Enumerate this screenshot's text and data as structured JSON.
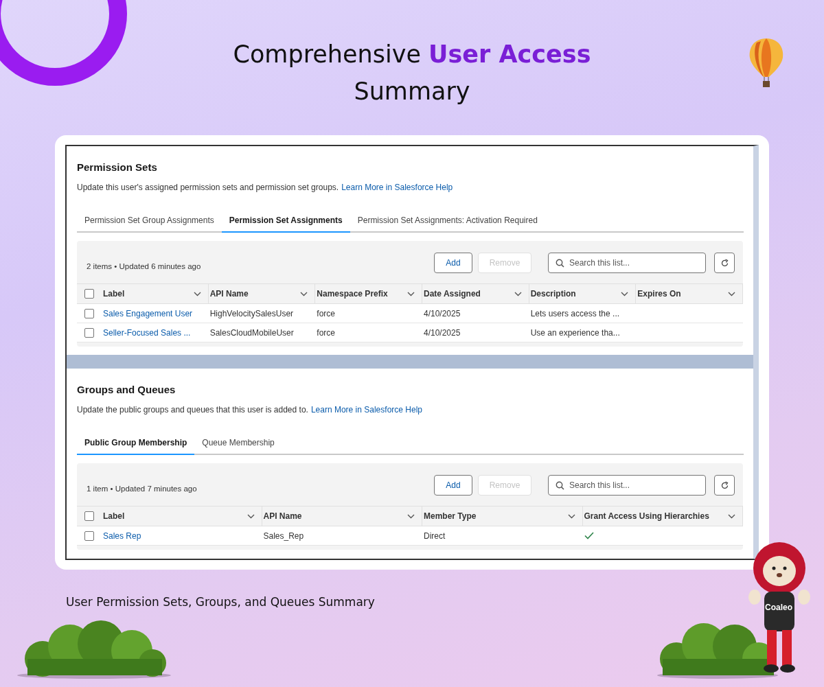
{
  "header": {
    "title": "Comprehensive **User Access** Summary"
  },
  "sections": [
    {
      "title": "Permission Sets",
      "description": "Update this user's assigned permission sets and permission set groups.",
      "link": "Learn More in Salesforce Help",
      "tabs": [
        {
          "label": "Permission Set Group Assignments",
          "selected": false
        },
        {
          "label": "Permission Set Assignments",
          "selected": true
        },
        {
          "label": "Permission Set Assignments: Activation Required",
          "selected": false
        }
      ],
      "list": {
        "status": "2 items • Updated 6 minutes ago",
        "add": "Add",
        "remove": "Remove",
        "remove_disabled": true,
        "search_placeholder": "Search this list...",
        "select_all_checked": false,
        "columns": [
          "Label",
          "API Name",
          "Namespace Prefix",
          "Date Assigned",
          "Description",
          "Expires On"
        ],
        "rows": [
          {
            "checked": false,
            "cells": [
              {
                "kind": "link",
                "text": "Sales Engagement User"
              },
              {
                "kind": "text",
                "text": "HighVelocitySalesUser"
              },
              {
                "kind": "text",
                "text": "force"
              },
              {
                "kind": "text",
                "text": "4/10/2025"
              },
              {
                "kind": "text",
                "text": "Lets users access the ..."
              }
            ]
          },
          {
            "checked": false,
            "cells": [
              {
                "kind": "link",
                "text": "Seller-Focused Sales ..."
              },
              {
                "kind": "text",
                "text": "SalesCloudMobileUser"
              },
              {
                "kind": "text",
                "text": "force"
              },
              {
                "kind": "text",
                "text": "4/10/2025"
              },
              {
                "kind": "text",
                "text": "Use an experience tha..."
              }
            ]
          }
        ]
      }
    },
    {
      "title": "Groups and Queues",
      "description": "Update the public groups and queues that this user is added to.",
      "link": "Learn More in Salesforce Help",
      "tabs": [
        {
          "label": "Public Group Membership",
          "selected": true
        },
        {
          "label": "Queue Membership",
          "selected": false
        }
      ],
      "list": {
        "status": "1 item • Updated 7 minutes ago",
        "add": "Add",
        "remove": "Remove",
        "remove_disabled": true,
        "search_placeholder": "Search this list...",
        "select_all_checked": false,
        "columns": [
          "Label",
          "API Name",
          "Member Type",
          "Grant Access Using Hierarchies"
        ],
        "rows": [
          {
            "checked": false,
            "cells": [
              {
                "kind": "link",
                "text": "Sales Rep"
              },
              {
                "kind": "text",
                "text": "Sales_Rep"
              },
              {
                "kind": "text",
                "text": "Direct"
              },
              {
                "kind": "check",
                "checked": true
              }
            ]
          }
        ]
      }
    }
  ],
  "caption": "User Permission Sets, Groups, and Queues Summary",
  "mascot": {
    "shirt_text": "Coaleo"
  }
}
